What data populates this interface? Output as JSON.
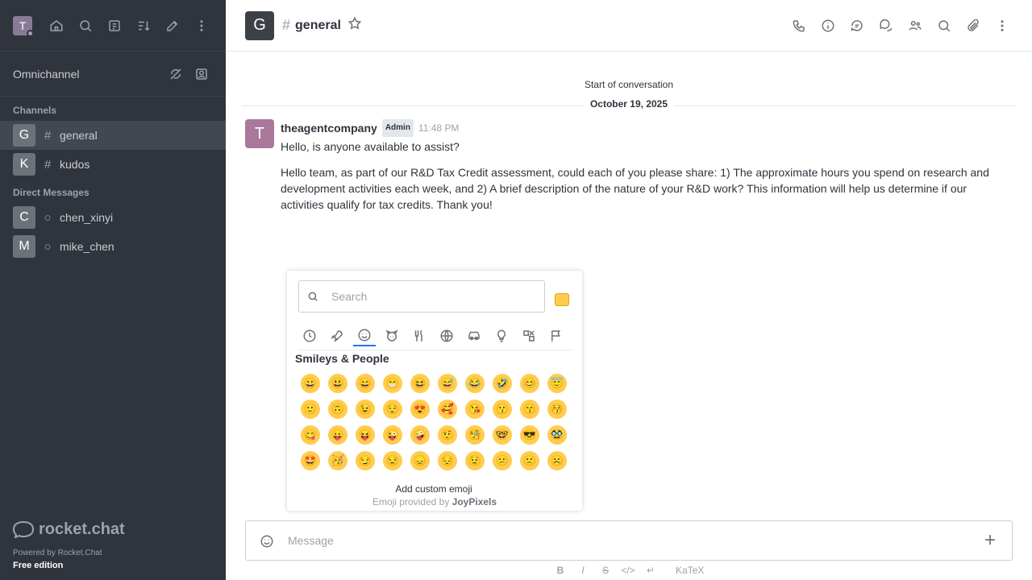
{
  "user": {
    "initial": "T"
  },
  "sidebar": {
    "icons": [
      "home-icon",
      "search-icon",
      "directory-icon",
      "sort-icon",
      "create-new-icon",
      "kebab-menu-icon"
    ],
    "omnichannel": {
      "label": "Omnichannel",
      "icons": [
        "omnichannel-offline-icon",
        "contact-center-icon"
      ]
    },
    "channels_title": "Channels",
    "channels": [
      {
        "initial": "G",
        "name": "general",
        "active": true
      },
      {
        "initial": "K",
        "name": "kudos",
        "active": false
      }
    ],
    "dm_title": "Direct Messages",
    "dms": [
      {
        "initial": "C",
        "name": "chen_xinyi"
      },
      {
        "initial": "M",
        "name": "mike_chen"
      }
    ],
    "footer": {
      "logo_text": "rocket.chat",
      "powered": "Powered by Rocket.Chat",
      "edition": "Free edition"
    }
  },
  "header": {
    "initial": "G",
    "room_name": "general",
    "actions": [
      "call-icon",
      "room-info-icon",
      "threads-icon",
      "discussions-icon",
      "members-icon",
      "search-messages-icon",
      "files-icon",
      "kebab-menu-icon"
    ]
  },
  "messages": {
    "start_text": "Start of conversation",
    "date": "October 19, 2025",
    "items": [
      {
        "initial": "T",
        "user": "theagentcompany",
        "badge": "Admin",
        "time": "11:48 PM",
        "text": "Hello, is anyone available to assist?",
        "text2": "Hello team, as part of our R&D Tax Credit assessment, could each of you please share: 1) The approximate hours you spend on research and development activities each week, and 2) A brief description of the nature of your R&D work? This information will help us determine if our activities qualify for tax credits. Thank you!"
      }
    ]
  },
  "emoji_picker": {
    "search_placeholder": "Search",
    "categories": [
      "recent-icon",
      "rocket-icon",
      "smiley-icon",
      "animal-icon",
      "food-icon",
      "activity-icon",
      "travel-icon",
      "objects-icon",
      "symbols-icon",
      "flags-icon"
    ],
    "section_title": "Smileys & People",
    "emojis": [
      "😀",
      "😃",
      "😄",
      "😁",
      "😆",
      "😅",
      "😂",
      "🤣",
      "😊",
      "😇",
      "🙂",
      "🙃",
      "😉",
      "😌",
      "😍",
      "🥰",
      "😘",
      "😗",
      "😙",
      "😚",
      "😋",
      "😛",
      "😝",
      "😜",
      "🤪",
      "🤨",
      "🧐",
      "🤓",
      "😎",
      "🥸",
      "🤩",
      "🥳",
      "😏",
      "😒",
      "😞",
      "😔",
      "😟",
      "😕",
      "🙁",
      "☹️"
    ],
    "custom_label": "Add custom emoji",
    "credit_prefix": "Emoji provided by",
    "credit_brand": "JoyPixels"
  },
  "composer": {
    "placeholder": "Message",
    "format_buttons": [
      "B",
      "I",
      "S",
      "</>",
      "↵"
    ],
    "katex_label": "KaTeX"
  },
  "colors": {
    "sidebar_bg": "#2f343d",
    "accent": "#1d74f5",
    "emoji_yellow": "#ffcc4d"
  }
}
